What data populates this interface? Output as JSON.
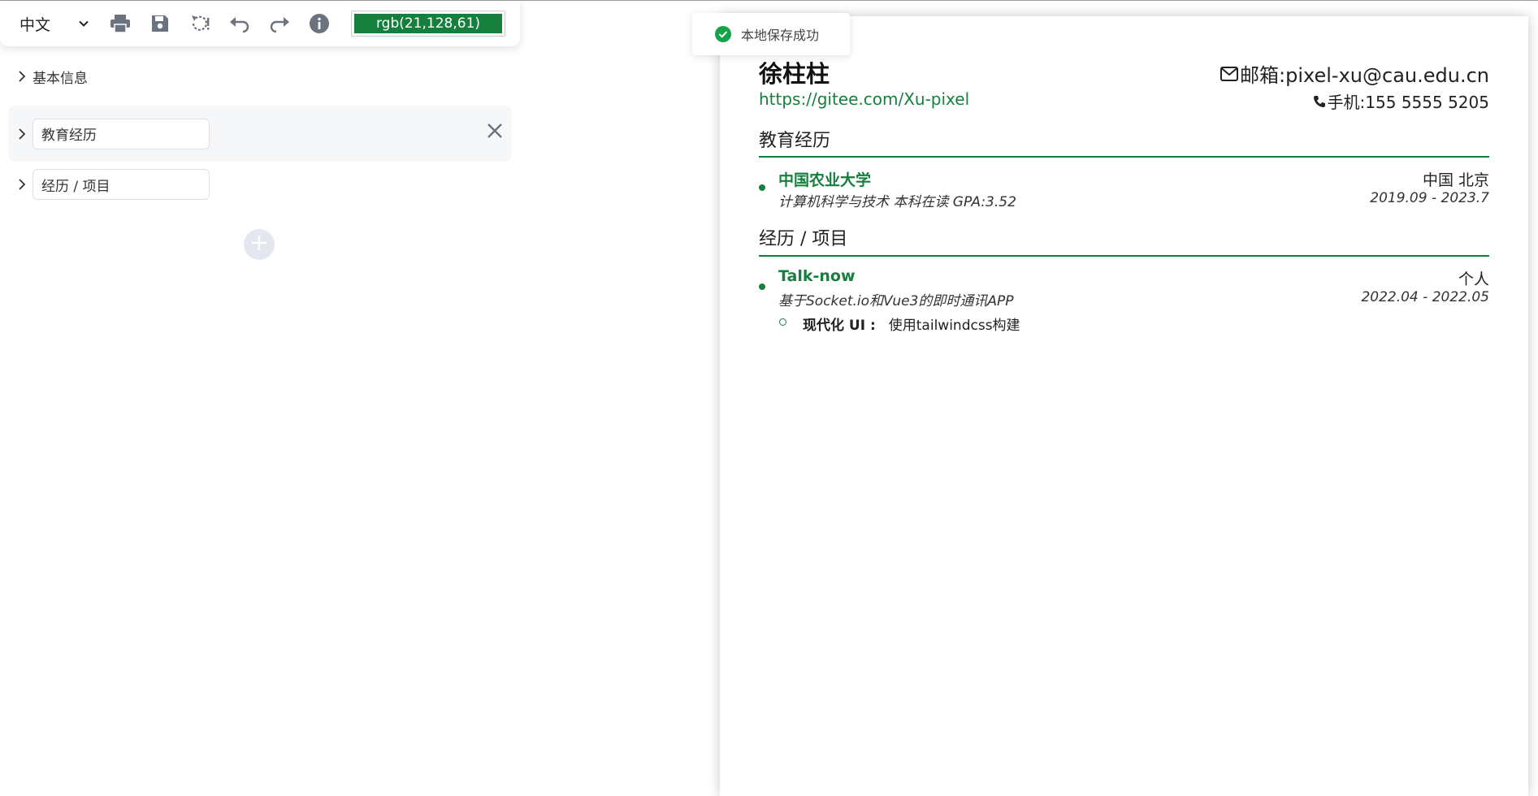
{
  "toolbar": {
    "language": "中文",
    "color_value": "rgb(21,128,61)",
    "icons": [
      "print-icon",
      "save-icon",
      "reset-icon",
      "undo-icon",
      "redo-icon",
      "info-icon"
    ]
  },
  "panel": {
    "basic_info": "基本信息",
    "education_value": "教育经历",
    "experience_value": "经历 / 项目"
  },
  "toast": {
    "message": "本地保存成功"
  },
  "resume": {
    "name": "徐柱柱",
    "link": "https://gitee.com/Xu-pixel",
    "email": "邮箱:pixel-xu@cau.edu.cn",
    "phone": "手机:155 5555 5205",
    "education": {
      "title": "教育经历",
      "school": "中国农业大学",
      "detail": "计算机科学与技术 本科在读 GPA:3.52",
      "location": "中国 北京",
      "date": "2019.09 - 2023.7"
    },
    "experience": {
      "title": "经历 / 项目",
      "project": "Talk-now",
      "detail": "基于Socket.io和Vue3的即时通讯APP",
      "role": "个人",
      "date": "2022.04 - 2022.05",
      "bullet_label": "现代化 UI :",
      "bullet_text": "使用tailwindcss构建"
    }
  },
  "colors": {
    "accent": "#15803d",
    "toast_success": "#15a34a"
  }
}
